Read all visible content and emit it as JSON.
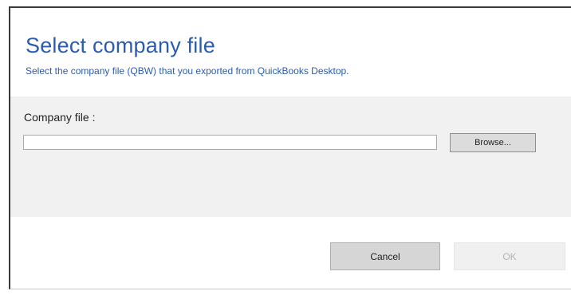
{
  "dialog": {
    "title": "Select company file",
    "subtitle": "Select the company file (QBW) that you exported from QuickBooks Desktop.",
    "company_file_label": "Company file :",
    "company_file_value": "",
    "browse_label": "Browse...",
    "cancel_label": "Cancel",
    "ok_label": "OK",
    "ok_enabled": false
  },
  "colors": {
    "title": "#2a5db0",
    "panel_background": "#f1f1f1",
    "button_background": "#d6d6d6",
    "disabled_button_text": "#b5b5b5"
  }
}
